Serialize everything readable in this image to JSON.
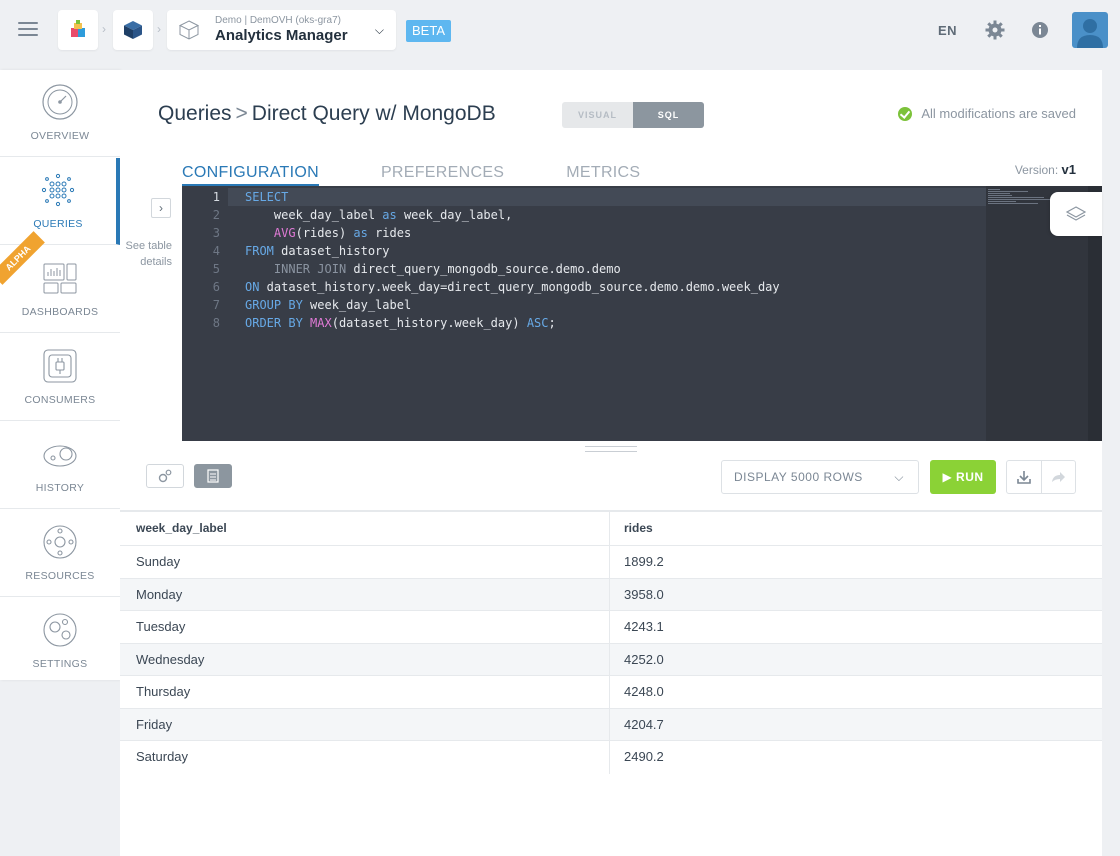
{
  "header": {
    "app_subtitle": "Demo | DemOVH (oks-gra7)",
    "app_title": "Analytics Manager",
    "beta_label": "BETA",
    "language": "EN"
  },
  "sidebar": {
    "items": [
      {
        "label": "OVERVIEW"
      },
      {
        "label": "QUERIES"
      },
      {
        "label": "DASHBOARDS"
      },
      {
        "label": "CONSUMERS"
      },
      {
        "label": "HISTORY"
      },
      {
        "label": "RESOURCES"
      },
      {
        "label": "SETTINGS"
      }
    ],
    "active": "QUERIES",
    "alpha_badge": "ALPHA"
  },
  "page": {
    "title_parent": "Queries",
    "title_separator": ">",
    "title_current": "Direct Query w/ MongoDB",
    "toggle_visual": "VISUAL",
    "toggle_sql": "SQL",
    "toggle_active": "SQL",
    "saved_status": "All modifications are saved",
    "tabs": [
      {
        "label": "CONFIGURATION",
        "active": true
      },
      {
        "label": "PREFERENCES",
        "active": false
      },
      {
        "label": "METRICS",
        "active": false
      }
    ],
    "version_label": "Version:",
    "version_value": "v1",
    "see_table_details": "See table details"
  },
  "editor": {
    "current_line": 1,
    "lines": [
      "SELECT",
      "    week_day_label as week_day_label,",
      "    AVG(rides) as rides",
      "FROM dataset_history",
      "    INNER JOIN direct_query_mongodb_source.demo.demo",
      "ON dataset_history.week_day=direct_query_mongodb_source.demo.demo.week_day",
      "GROUP BY week_day_label",
      "ORDER BY MAX(dataset_history.week_day) ASC;"
    ]
  },
  "results": {
    "display_rows": "DISPLAY 5000 ROWS",
    "run_label": "RUN",
    "columns": [
      "week_day_label",
      "rides"
    ],
    "rows": [
      [
        "Sunday",
        "1899.2"
      ],
      [
        "Monday",
        "3958.0"
      ],
      [
        "Tuesday",
        "4243.1"
      ],
      [
        "Wednesday",
        "4252.0"
      ],
      [
        "Thursday",
        "4248.0"
      ],
      [
        "Friday",
        "4204.7"
      ],
      [
        "Saturday",
        "2490.2"
      ]
    ]
  },
  "colors": {
    "accent": "#2a79b6",
    "run": "#8bd236",
    "beta": "#5eb7f0",
    "saved_check": "#7cc23a",
    "editor_bg": "#383d47"
  }
}
